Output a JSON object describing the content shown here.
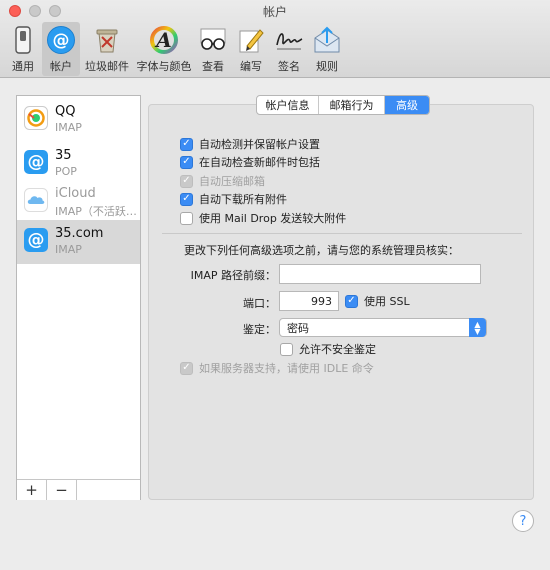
{
  "window": {
    "title": "帐户"
  },
  "toolbar": {
    "items": [
      {
        "label": "通用",
        "icon": "switch-icon"
      },
      {
        "label": "帐户",
        "icon": "at-icon"
      },
      {
        "label": "垃圾邮件",
        "icon": "trash-icon"
      },
      {
        "label": "字体与颜色",
        "icon": "font-icon"
      },
      {
        "label": "查看",
        "icon": "glasses-icon"
      },
      {
        "label": "编写",
        "icon": "pencil-icon"
      },
      {
        "label": "签名",
        "icon": "signature-icon"
      },
      {
        "label": "规则",
        "icon": "rules-icon"
      }
    ],
    "active_index": 1
  },
  "accounts": [
    {
      "name": "QQ",
      "type": "IMAP",
      "icon": "qq-icon"
    },
    {
      "name": "35",
      "type": "POP",
      "icon": "at-icon"
    },
    {
      "name": "iCloud",
      "type": "IMAP（不活跃…",
      "icon": "icloud-icon"
    },
    {
      "name": "35.com",
      "type": "IMAP",
      "icon": "at-icon"
    }
  ],
  "sidebar_buttons": {
    "add": "+",
    "remove": "−"
  },
  "tabs": [
    {
      "label": "帐户信息"
    },
    {
      "label": "邮箱行为"
    },
    {
      "label": "高级"
    }
  ],
  "options": {
    "auto_detect": "自动检测并保留帐户设置",
    "include_in_check": "在自动检查新邮件时包括",
    "compact_mailboxes": "自动压缩邮箱",
    "download_attachments": "自动下载所有附件",
    "mail_drop": "使用 Mail Drop 发送较大附件"
  },
  "advanced": {
    "notice": "更改下列任何高级选项之前，请与您的系统管理员核实：",
    "imap_prefix_label": "IMAP 路径前缀：",
    "imap_prefix_value": "",
    "port_label": "端口：",
    "port_value": "993",
    "ssl_label": "使用 SSL",
    "auth_label": "鉴定：",
    "auth_value": "密码",
    "allow_insecure": "允许不安全鉴定",
    "idle": "如果服务器支持，请使用 IDLE 命令"
  },
  "help": "?",
  "colors": {
    "accent": "#3b8cf4",
    "close": "#fc5f57"
  }
}
